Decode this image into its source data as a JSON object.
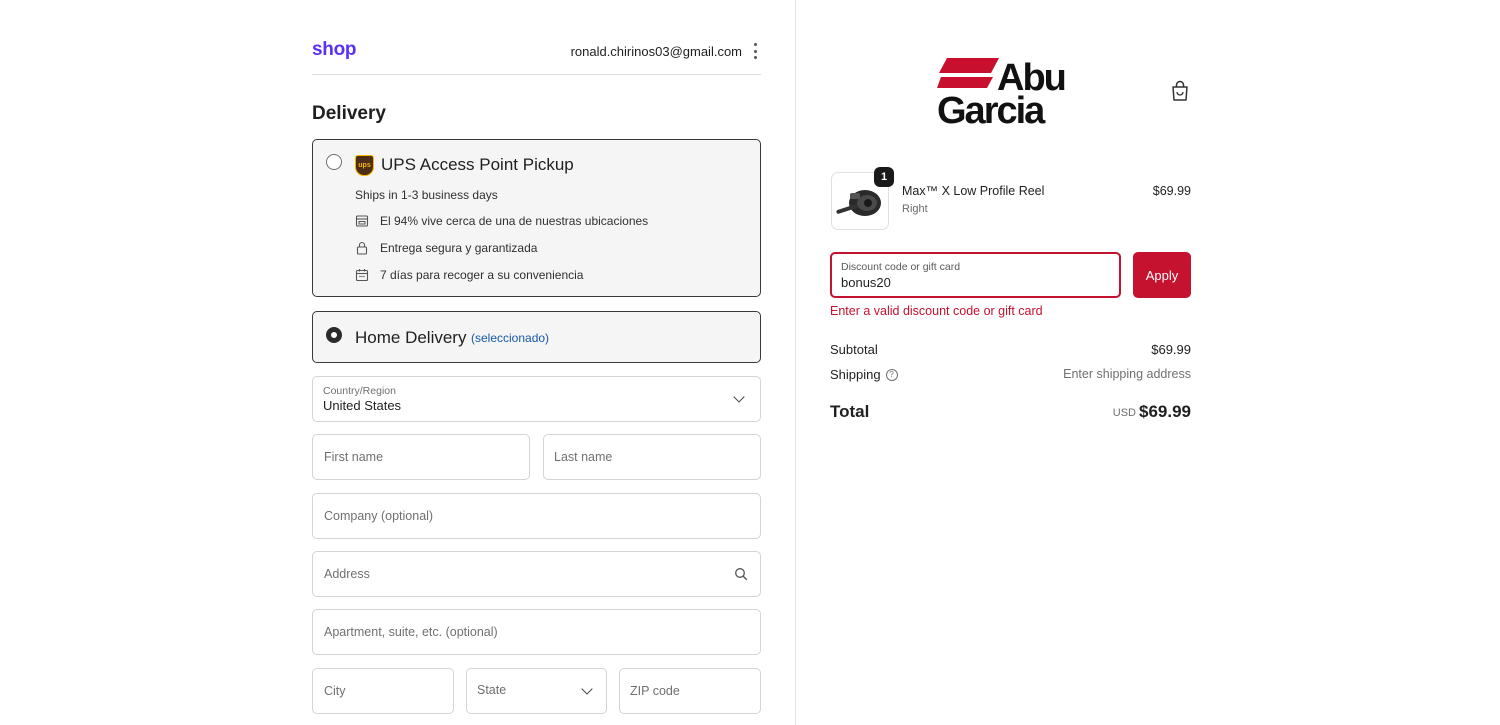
{
  "header": {
    "logo": "shop",
    "email": "ronald.chirinos03@gmail.com"
  },
  "delivery": {
    "title": "Delivery",
    "ups": {
      "badge": "ups",
      "title": "UPS Access Point Pickup",
      "subtitle": "Ships in 1-3 business days",
      "features": [
        {
          "icon": "store-icon",
          "text": "El 94% vive cerca de una de nuestras ubicaciones"
        },
        {
          "icon": "lock-icon",
          "text": "Entrega segura y garantizada"
        },
        {
          "icon": "calendar-icon",
          "text": "7 días para recoger a su conveniencia"
        }
      ]
    },
    "home": {
      "title": "Home Delivery",
      "selected_label": "(seleccionado)"
    }
  },
  "form": {
    "country_label": "Country/Region",
    "country_value": "United States",
    "first_name_placeholder": "First name",
    "last_name_placeholder": "Last name",
    "company_placeholder": "Company (optional)",
    "address_placeholder": "Address",
    "apartment_placeholder": "Apartment, suite, etc. (optional)",
    "city_placeholder": "City",
    "state_placeholder": "State",
    "zip_placeholder": "ZIP code"
  },
  "summary": {
    "brand": {
      "line1": "Abu",
      "line2": "Garcia"
    },
    "item": {
      "quantity": "1",
      "name": "Max™ X Low Profile Reel",
      "variant": "Right",
      "price": "$69.99"
    },
    "discount": {
      "label": "Discount code or gift card",
      "value": "bonus20",
      "apply_label": "Apply",
      "error": "Enter a valid discount code or gift card"
    },
    "subtotal_label": "Subtotal",
    "subtotal_value": "$69.99",
    "shipping_label": "Shipping",
    "shipping_value": "Enter shipping address",
    "total_label": "Total",
    "total_currency": "USD",
    "total_value": "$69.99"
  },
  "colors": {
    "shop_brand": "#5a31f4",
    "accent_red": "#c4122f",
    "link_blue": "#1558a8"
  }
}
